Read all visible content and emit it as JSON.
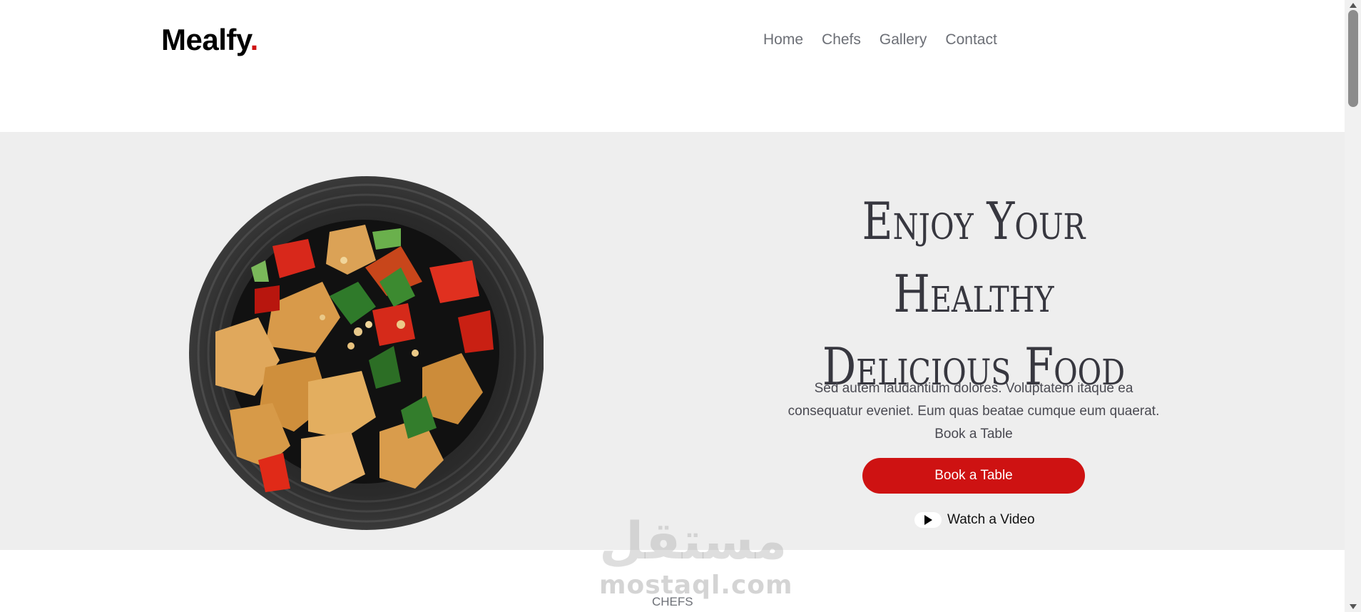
{
  "header": {
    "logo_text": "Mealfy",
    "logo_dot": ".",
    "nav": [
      "Home",
      "Chefs",
      "Gallery",
      "Contact"
    ]
  },
  "hero": {
    "title_line1": "Enjoy Your Healthy",
    "title_line2": "Delicious Food",
    "text_line1": "Sed autem laudantium dolores. Voluptatem itaque ea",
    "text_line2": "consequatur eveniet. Eum quas beatae cumque eum quaerat.",
    "text_line3": "Book a Table",
    "book_button": "Book a Table",
    "watch_label": "Watch a Video"
  },
  "watermark": {
    "arabic": "مستقل",
    "latin": "mostaql.com"
  },
  "next_section_label": "CHEFS",
  "colors": {
    "accent": "#ce1212",
    "hero_bg": "#eeeeee",
    "nav_text": "#6c6f76",
    "title_text": "#37373f"
  },
  "icons": {
    "play": "play-icon",
    "plate": "food-plate-image"
  }
}
